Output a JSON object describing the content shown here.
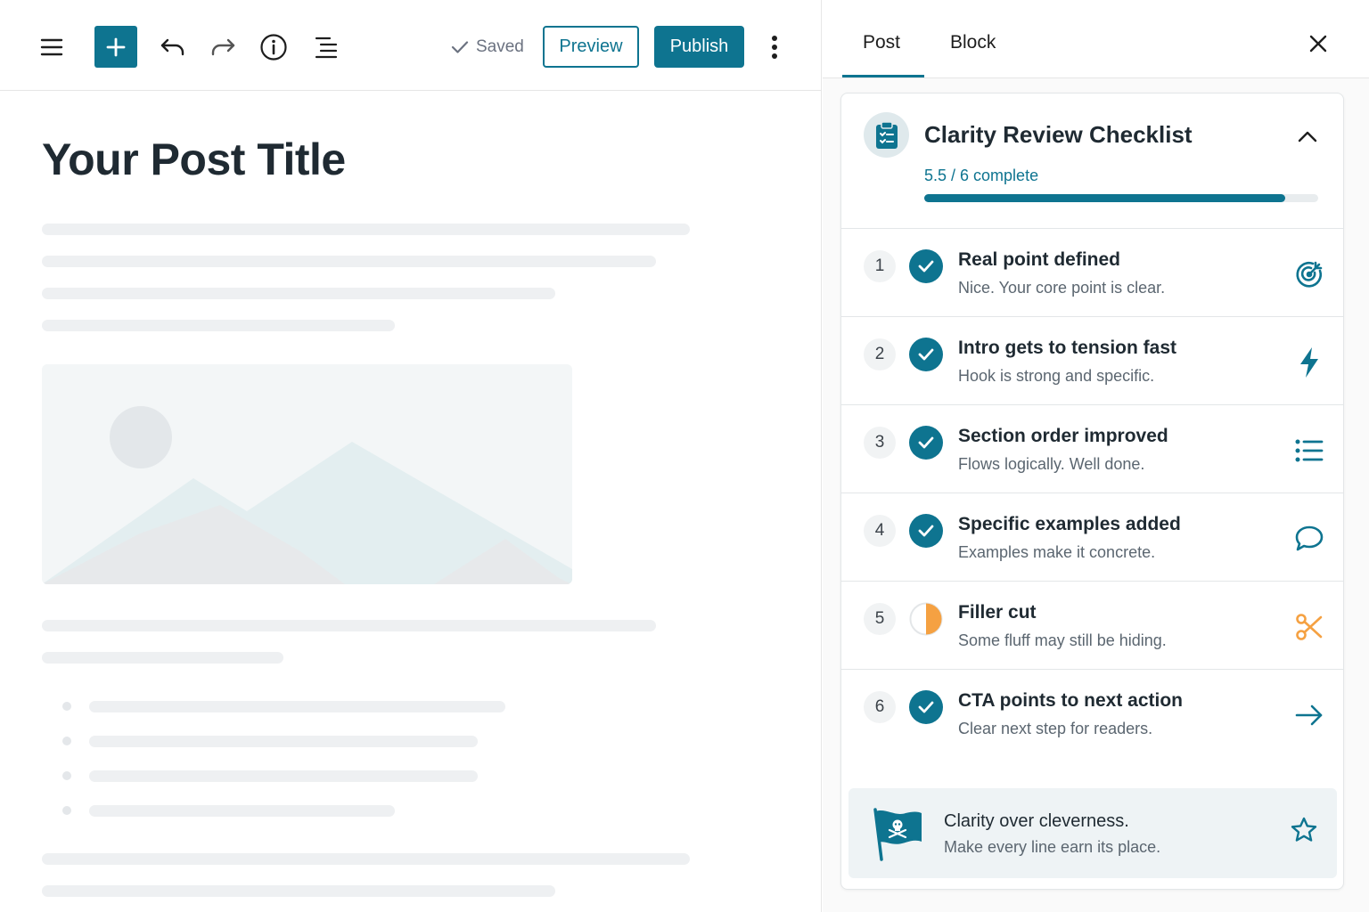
{
  "toolbar": {
    "saved_label": "Saved",
    "preview_label": "Preview",
    "publish_label": "Publish"
  },
  "post": {
    "title": "Your Post Title"
  },
  "sidebar": {
    "tabs": [
      {
        "label": "Post",
        "active": true
      },
      {
        "label": "Block",
        "active": false
      }
    ]
  },
  "checklist": {
    "title": "Clarity Review Checklist",
    "progress_text": "5.5 / 6 complete",
    "progress_fraction": 0.917,
    "items": [
      {
        "number": "1",
        "title": "Real point defined",
        "subtitle": "Nice. Your core point is clear.",
        "status": "done",
        "icon": "target-icon"
      },
      {
        "number": "2",
        "title": "Intro gets to tension fast",
        "subtitle": "Hook is strong and specific.",
        "status": "done",
        "icon": "lightning-icon"
      },
      {
        "number": "3",
        "title": "Section order improved",
        "subtitle": "Flows logically. Well done.",
        "status": "done",
        "icon": "list-icon"
      },
      {
        "number": "4",
        "title": "Specific examples added",
        "subtitle": "Examples make it concrete.",
        "status": "done",
        "icon": "speech-bubble-icon"
      },
      {
        "number": "5",
        "title": "Filler cut",
        "subtitle": "Some fluff may still be hiding.",
        "status": "half",
        "icon": "scissors-icon"
      },
      {
        "number": "6",
        "title": "CTA points to next action",
        "subtitle": "Clear next step for readers.",
        "status": "done",
        "icon": "arrow-right-icon"
      }
    ],
    "footer": {
      "title": "Clarity over cleverness.",
      "subtitle": "Make every line earn its place."
    }
  },
  "colors": {
    "accent": "#0e7490",
    "warning": "#f5a142"
  }
}
